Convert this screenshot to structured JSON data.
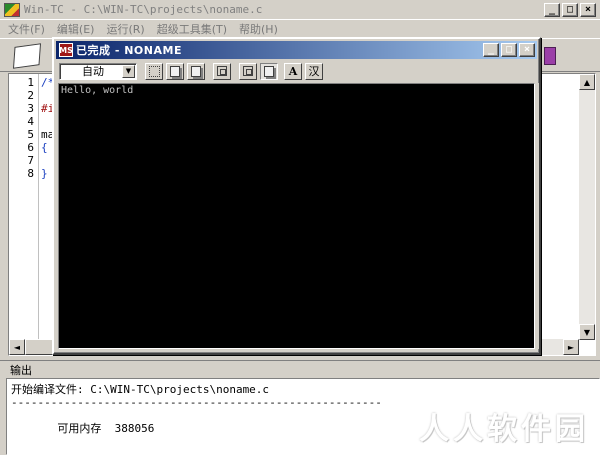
{
  "main_window": {
    "title": "Win-TC - C:\\WIN-TC\\projects\\noname.c",
    "controls": {
      "minimize": "_",
      "maximize": "□",
      "close": "×"
    }
  },
  "menu": {
    "items": [
      {
        "label": "文件(F)"
      },
      {
        "label": "编辑(E)"
      },
      {
        "label": "运行(R)"
      },
      {
        "label": "超级工具集(T)"
      },
      {
        "label": "帮助(H)"
      }
    ]
  },
  "editor": {
    "line_numbers": [
      "1",
      "2",
      "3",
      "4",
      "5",
      "6",
      "7",
      "8"
    ],
    "lines": [
      "/*",
      "",
      "#i",
      "",
      "ma",
      "{",
      "",
      "}"
    ],
    "scroll": {
      "up": "▲",
      "down": "▼",
      "left": "◄",
      "right": "►"
    }
  },
  "console_window": {
    "title": "已完成 - NONAME",
    "icon_text": "MS",
    "font_select": {
      "value": "自动",
      "arrow": "▼"
    },
    "toolbar": {
      "font_button": "A",
      "ime_button": "汉"
    },
    "controls": {
      "minimize": "_",
      "maximize": "□",
      "close": "×"
    },
    "output_text": "Hello, world"
  },
  "output_panel": {
    "header": "输出",
    "lines": [
      "开始编译文件: C:\\WIN-TC\\projects\\noname.c",
      "--------------------------------------------------------",
      "",
      "       可用内存  388056"
    ]
  },
  "watermark": "人人软件园",
  "colors": {
    "window_bg": "#d4d0c8",
    "title_active_start": "#0a246a",
    "title_active_end": "#a6caf0",
    "console_bg": "#000000",
    "console_text": "#c0c0c0"
  }
}
